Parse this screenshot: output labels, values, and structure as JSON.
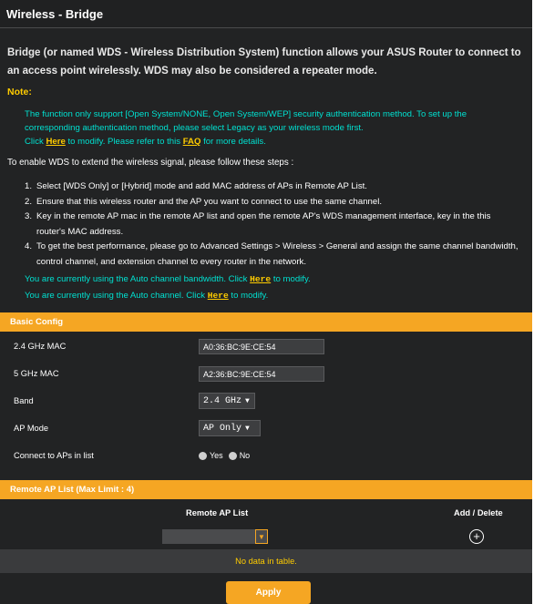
{
  "title": "Wireless - Bridge",
  "intro": "Bridge (or named WDS - Wireless Distribution System) function allows your ASUS Router to connect to an access point wirelessly. WDS may also be considered a repeater mode.",
  "note": {
    "label": "Note:",
    "line1": "The function only support [Open System/NONE, Open System/WEP] security authentication method. To set up the corresponding authentication method, please select Legacy as your wireless mode first.",
    "click": "Click",
    "here": "Here",
    "mid": "to modify. Please refer to this",
    "faq": "FAQ",
    "end": "for more details."
  },
  "steps_intro": "To enable WDS to extend the wireless signal, please follow these steps :",
  "steps": [
    {
      "num": "1.",
      "text": "Select [WDS Only] or [Hybrid] mode and add MAC address of APs in Remote AP List."
    },
    {
      "num": "2.",
      "text": "Ensure that this wireless router and the AP you want to connect to use the same channel."
    },
    {
      "num": "3.",
      "text": "Key in the remote AP mac in the remote AP list and open the remote AP's WDS management interface, key in the this router's MAC address."
    },
    {
      "num": "4.",
      "text": "To get the best performance, please go to Advanced Settings > Wireless > General and assign the same channel bandwidth, control channel, and extension channel to every router in the network."
    }
  ],
  "auto_bw": {
    "pre": "You are currently using the Auto channel bandwidth. Click",
    "here": "Here",
    "post": "to modify."
  },
  "auto_ch": {
    "pre": "You are currently using the Auto channel. Click",
    "here": "Here",
    "post": "to modify."
  },
  "basic_config": {
    "header": "Basic Config",
    "mac24_label": "2.4 GHz MAC",
    "mac24_value": "A0:36:BC:9E:CE:54",
    "mac5_label": "5 GHz MAC",
    "mac5_value": "A2:36:BC:9E:CE:54",
    "band_label": "Band",
    "band_value": "2.4 GHz",
    "apmode_label": "AP Mode",
    "apmode_value": "AP Only",
    "connect_label": "Connect to APs in list",
    "yes": "Yes",
    "no": "No"
  },
  "remote": {
    "header": "Remote AP List (Max Limit : 4)",
    "col_list": "Remote AP List",
    "col_action": "Add / Delete",
    "empty": "No data in table."
  },
  "apply_label": "Apply",
  "colors": {
    "accent": "#f5a623",
    "cyan": "#00e0d0",
    "link": "#ffcc00"
  }
}
